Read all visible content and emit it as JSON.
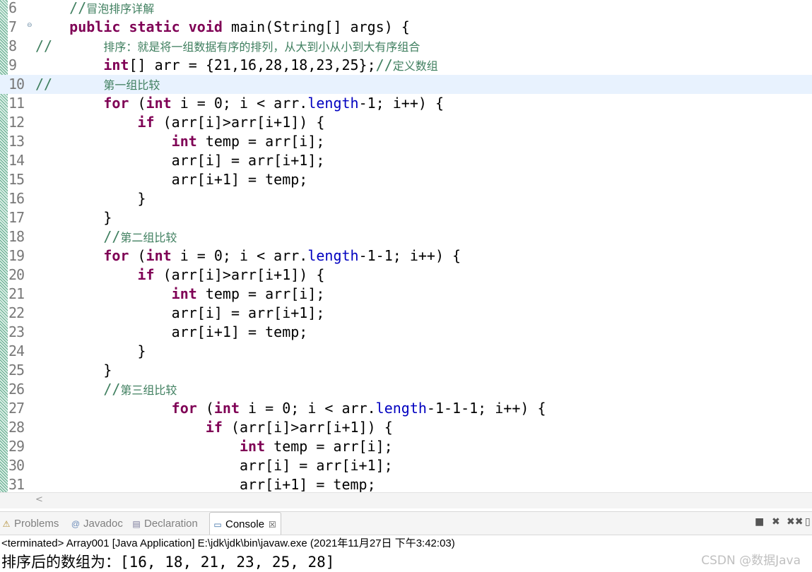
{
  "editor": {
    "lines": [
      {
        "n": "6",
        "fold": "",
        "html": "    <span class=\"cm\">//</span><span class=\"cmzh\">冒泡排序详解</span>"
      },
      {
        "n": "7",
        "fold": "⊖",
        "html": "    <span class=\"kw\">public static void</span> main(String[] args) {"
      },
      {
        "n": "8",
        "fold": "",
        "html": "<span class=\"slash\">//</span>      <span class=\"cmzh\">排序：就是将一组数据有序的排列，从大到小从小到大有序组合</span>"
      },
      {
        "n": "9",
        "fold": "",
        "html": "        <span class=\"kw\">int</span>[] arr = {21,16,28,18,23,25};<span class=\"cm\">//</span><span class=\"cmzh\">定义数组</span>"
      },
      {
        "n": "10",
        "fold": "",
        "hl": true,
        "html": "<span class=\"slash\">//</span>      <span class=\"cmzh\">第一组比较</span>"
      },
      {
        "n": "11",
        "fold": "",
        "html": "        <span class=\"kw\">for</span> (<span class=\"kw\">int</span> i = 0; i &lt; arr.<span class=\"fld\">length</span>-1; i++) {"
      },
      {
        "n": "12",
        "fold": "",
        "html": "            <span class=\"kw\">if</span> (arr[i]&gt;arr[i+1]) {"
      },
      {
        "n": "13",
        "fold": "",
        "html": "                <span class=\"kw\">int</span> temp = arr[i];"
      },
      {
        "n": "14",
        "fold": "",
        "html": "                arr[i] = arr[i+1];"
      },
      {
        "n": "15",
        "fold": "",
        "html": "                arr[i+1] = temp;"
      },
      {
        "n": "16",
        "fold": "",
        "html": "            }"
      },
      {
        "n": "17",
        "fold": "",
        "html": "        }"
      },
      {
        "n": "18",
        "fold": "",
        "html": "        <span class=\"cm\">//</span><span class=\"cmzh\">第二组比较</span>"
      },
      {
        "n": "19",
        "fold": "",
        "html": "        <span class=\"kw\">for</span> (<span class=\"kw\">int</span> i = 0; i &lt; arr.<span class=\"fld\">length</span>-1-1; i++) {"
      },
      {
        "n": "20",
        "fold": "",
        "html": "            <span class=\"kw\">if</span> (arr[i]&gt;arr[i+1]) {"
      },
      {
        "n": "21",
        "fold": "",
        "html": "                <span class=\"kw\">int</span> temp = arr[i];"
      },
      {
        "n": "22",
        "fold": "",
        "html": "                arr[i] = arr[i+1];"
      },
      {
        "n": "23",
        "fold": "",
        "html": "                arr[i+1] = temp;"
      },
      {
        "n": "24",
        "fold": "",
        "html": "            }"
      },
      {
        "n": "25",
        "fold": "",
        "html": "        }"
      },
      {
        "n": "26",
        "fold": "",
        "html": "        <span class=\"cm\">//</span><span class=\"cmzh\">第三组比较</span>"
      },
      {
        "n": "27",
        "fold": "",
        "html": "                <span class=\"kw\">for</span> (<span class=\"kw\">int</span> i = 0; i &lt; arr.<span class=\"fld\">length</span>-1-1-1; i++) {"
      },
      {
        "n": "28",
        "fold": "",
        "html": "                    <span class=\"kw\">if</span> (arr[i]&gt;arr[i+1]) {"
      },
      {
        "n": "29",
        "fold": "",
        "html": "                        <span class=\"kw\">int</span> temp = arr[i];"
      },
      {
        "n": "30",
        "fold": "",
        "html": "                        arr[i] = arr[i+1];"
      },
      {
        "n": "31",
        "fold": "",
        "html": "                        arr[i+1] = temp;"
      }
    ]
  },
  "scrollbar": {
    "left_arrow": "<"
  },
  "panel": {
    "tabs": [
      {
        "label": "Problems",
        "icon": "problems-icon",
        "glyph": "⚠"
      },
      {
        "label": "Javadoc",
        "icon": "javadoc-icon",
        "glyph": "@"
      },
      {
        "label": "Declaration",
        "icon": "declaration-icon",
        "glyph": "▤"
      },
      {
        "label": "Console",
        "icon": "console-icon",
        "glyph": "▭",
        "active": true
      }
    ],
    "close_glyph": "☒",
    "toolbar": {
      "stop": "■",
      "remove": "✖",
      "remove_all": "✖✖",
      "more": "▯"
    },
    "status": "<terminated> Array001 [Java Application] E:\\jdk\\jdk\\bin\\javaw.exe (2021年11月27日 下午3:42:03)",
    "output": "排序后的数组为：[16, 18, 21, 23, 25, 28]"
  },
  "watermark": "CSDN @数据Java"
}
